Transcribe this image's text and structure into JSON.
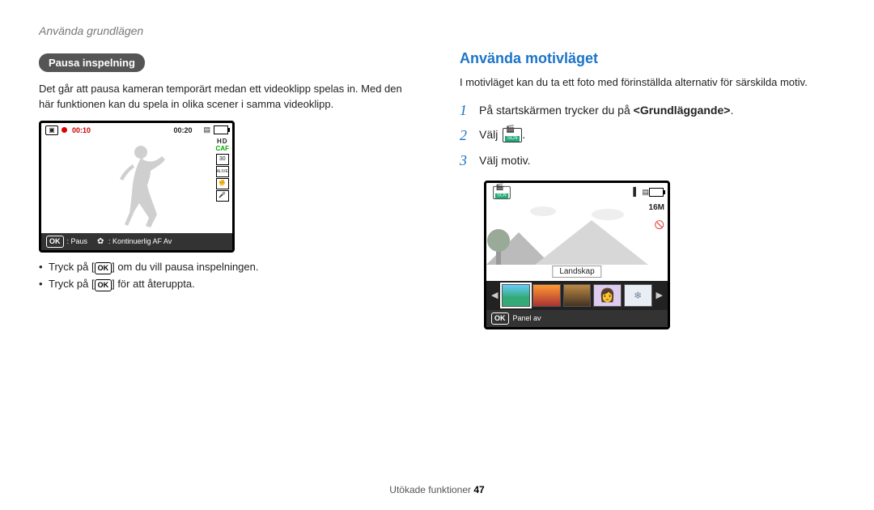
{
  "breadcrumb": "Använda grundlägen",
  "left": {
    "pill": "Pausa inspelning",
    "paragraph": "Det går att pausa kameran temporärt medan ett videoklipp spelas in. Med den här funktionen kan du spela in olika scener i samma videoklipp.",
    "screen": {
      "rec_time": "00:10",
      "total_time": "00:20",
      "caf": "CAF",
      "hd": "HD",
      "bottom_ok": "OK",
      "bottom_pause": ": Paus",
      "bottom_af": ": Kontinuerlig AF Av"
    },
    "bullets": {
      "b1_pre": "Tryck på [",
      "b1_ok": "OK",
      "b1_post": "] om du vill pausa inspelningen.",
      "b2_pre": "Tryck på [",
      "b2_ok": "OK",
      "b2_post": "] för att återuppta."
    }
  },
  "right": {
    "heading": "Använda motivläget",
    "paragraph": "I motivläget kan du ta ett foto med förinställda alternativ för särskilda motiv.",
    "steps": {
      "s1_pre": "På startskärmen trycker du på ",
      "s1_bold": "<Grundläggande>",
      "s1_post": ".",
      "s2": "Välj ",
      "s2_post": ".",
      "s3": "Välj motiv."
    },
    "screen2": {
      "mp": "16M",
      "label": "Landskap",
      "bottom_ok": "OK",
      "bottom_text": "Panel av"
    }
  },
  "footer": {
    "text": "Utökade funktioner  ",
    "page": "47"
  }
}
